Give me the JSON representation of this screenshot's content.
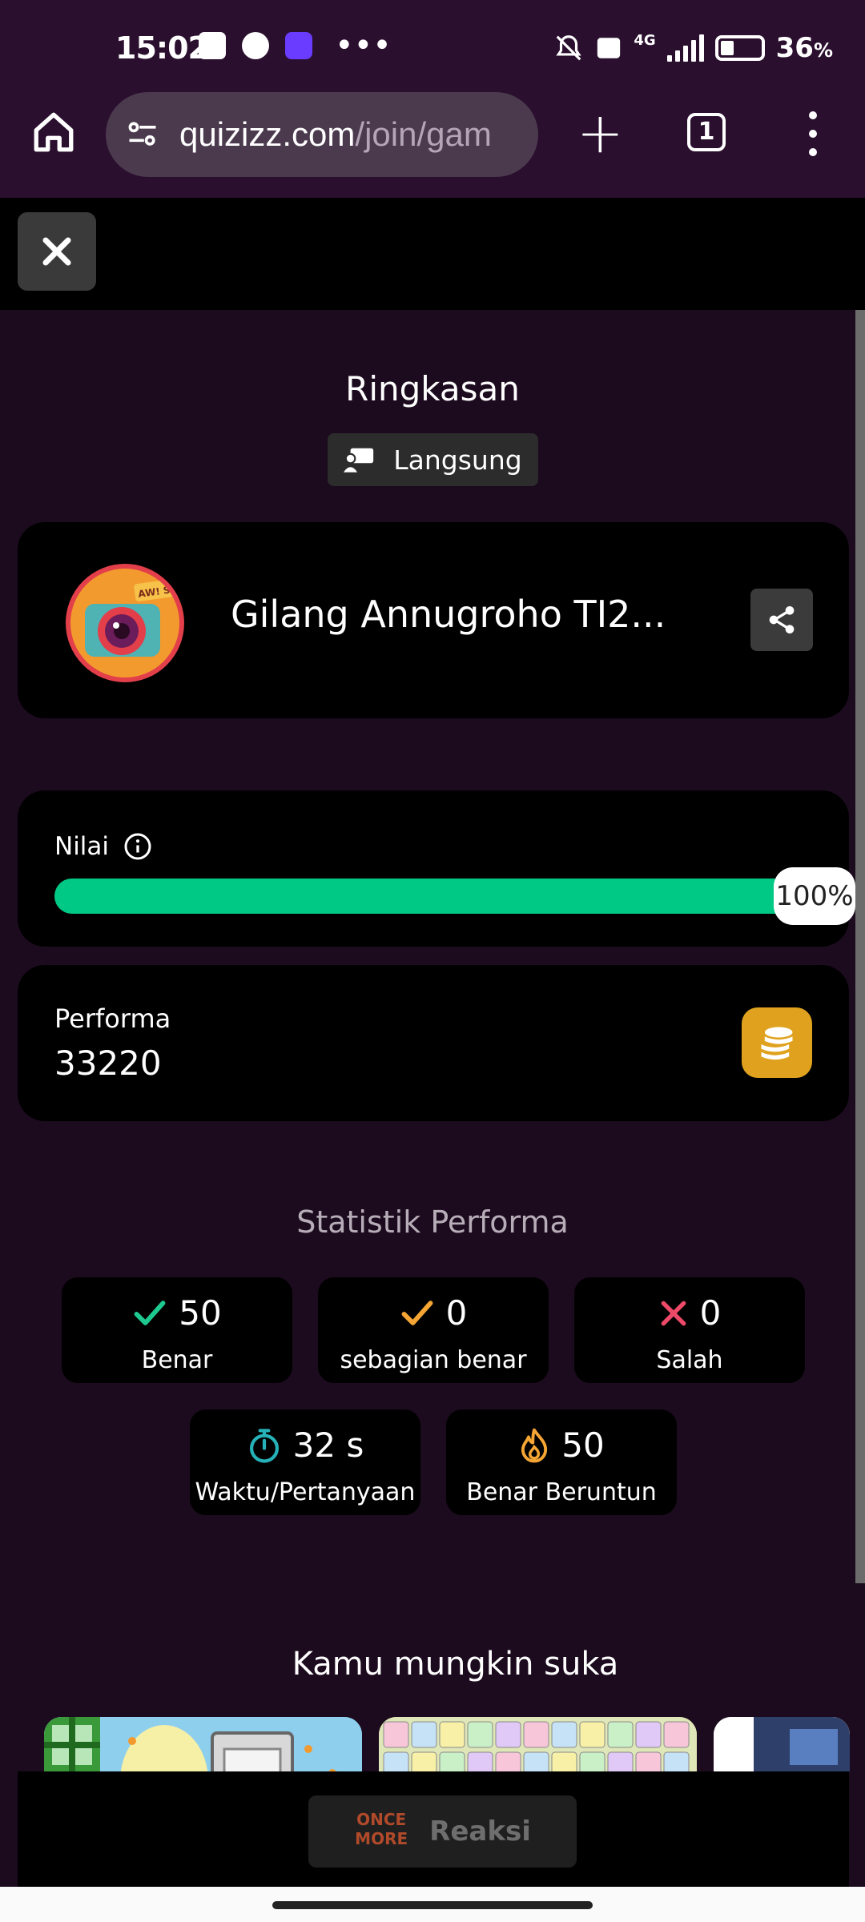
{
  "status_bar": {
    "time": "15:02",
    "dots": "•••",
    "battery": "36",
    "battery_unit": "%",
    "network": "4G",
    "icons": [
      "message-icon",
      "pinterest-icon",
      "lazada-icon",
      "muted-bell-icon",
      "volte-icon",
      "signal-icon",
      "battery-icon"
    ]
  },
  "browser": {
    "url_host": "quizizz.com",
    "url_path": "/join/gam",
    "tab_count": "1"
  },
  "summary": {
    "title": "Ringkasan",
    "mode": "Langsung"
  },
  "player": {
    "name": "Gilang Annugroho TI2...",
    "avatar_badge": "AW! SNAP!"
  },
  "score": {
    "label": "Nilai",
    "percent_text": "100%",
    "progress_fraction": 1.0
  },
  "performance": {
    "label": "Performa",
    "value": "33220"
  },
  "stats": {
    "title": "Statistik Performa",
    "items": [
      {
        "value": "50",
        "label": "Benar",
        "icon": "check-icon",
        "color": "#1ec98f"
      },
      {
        "value": "0",
        "label": "sebagian benar",
        "icon": "check-icon",
        "color": "#f4a534"
      },
      {
        "value": "0",
        "label": "Salah",
        "icon": "cross-icon",
        "color": "#ec4a68"
      },
      {
        "value": "32 s",
        "label": "Waktu/Pertanyaan",
        "icon": "stopwatch-icon",
        "color": "#26b0b8"
      },
      {
        "value": "50",
        "label": "Benar Beruntun",
        "icon": "flame-icon",
        "color": "#f4a534"
      }
    ]
  },
  "suggestions": {
    "title": "Kamu mungkin suka"
  },
  "reactions": {
    "logo_line1": "ONCE",
    "logo_line2": "MORE",
    "label": "Reaksi"
  },
  "colors": {
    "accent_green": "#00c985",
    "coin": "#e0a21e",
    "background": "#1c0b1e",
    "browser_chrome": "#2a0f2e"
  }
}
